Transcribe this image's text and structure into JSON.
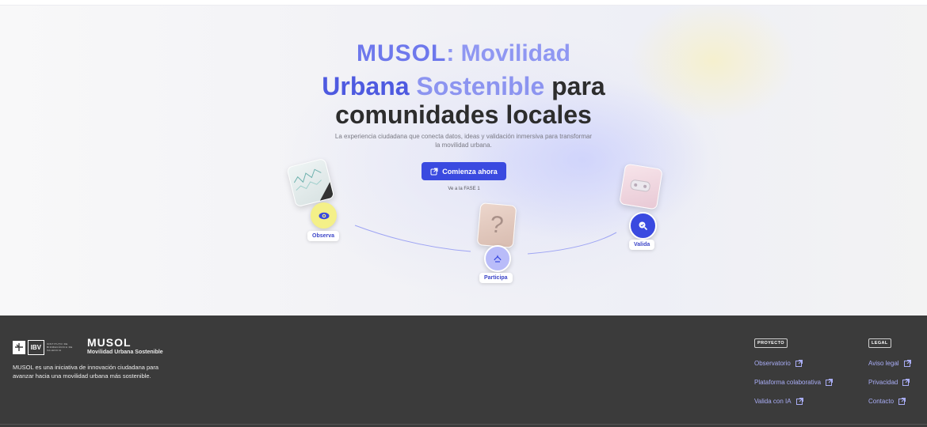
{
  "hero": {
    "title_brand": "MUSOL",
    "title_line1_rest": ": Movilidad",
    "title_line2_a": "Urbana",
    "title_line2_b": "Sostenible",
    "title_line2_c": "para",
    "title_line3": "comunidades locales",
    "subtitle": "La experiencia ciudadana que conecta datos, ideas y validación inmersiva para transformar la movilidad urbana.",
    "cta_label": "Comienza ahora",
    "cta_hint": "Ve a la FASE 1",
    "phases": [
      {
        "label": "Observa",
        "icon": "eye-icon"
      },
      {
        "label": "Participa",
        "icon": "hands-icon"
      },
      {
        "label": "Valida",
        "icon": "search-check-icon"
      }
    ],
    "card2_glyph": "?"
  },
  "footer": {
    "ibv_label": "IBV",
    "ibv_text": "INSTITUTO DE BIOMECÁNICA DE VALENCIA",
    "brand": "MUSOL",
    "brand_sub": "Movilidad Urbana Sostenible",
    "description": "MUSOL es una iniciativa de innovación ciudadana para avanzar hacia una movilidad urbana más sostenible.",
    "proyecto": {
      "heading": "PROYECTO",
      "links": [
        "Observatorio",
        "Plataforma colaborativa",
        "Valida con IA"
      ]
    },
    "legal": {
      "heading": "LEGAL",
      "links": [
        "Aviso legal",
        "Privacidad",
        "Contacto"
      ]
    }
  },
  "colors": {
    "accent": "#3a4ae0",
    "accent_light": "#8f97f2",
    "footer_bg": "#3b3b3b",
    "link": "#a9adf6",
    "observa_node": "#f4f088",
    "participa_node": "#b9bcf9"
  }
}
